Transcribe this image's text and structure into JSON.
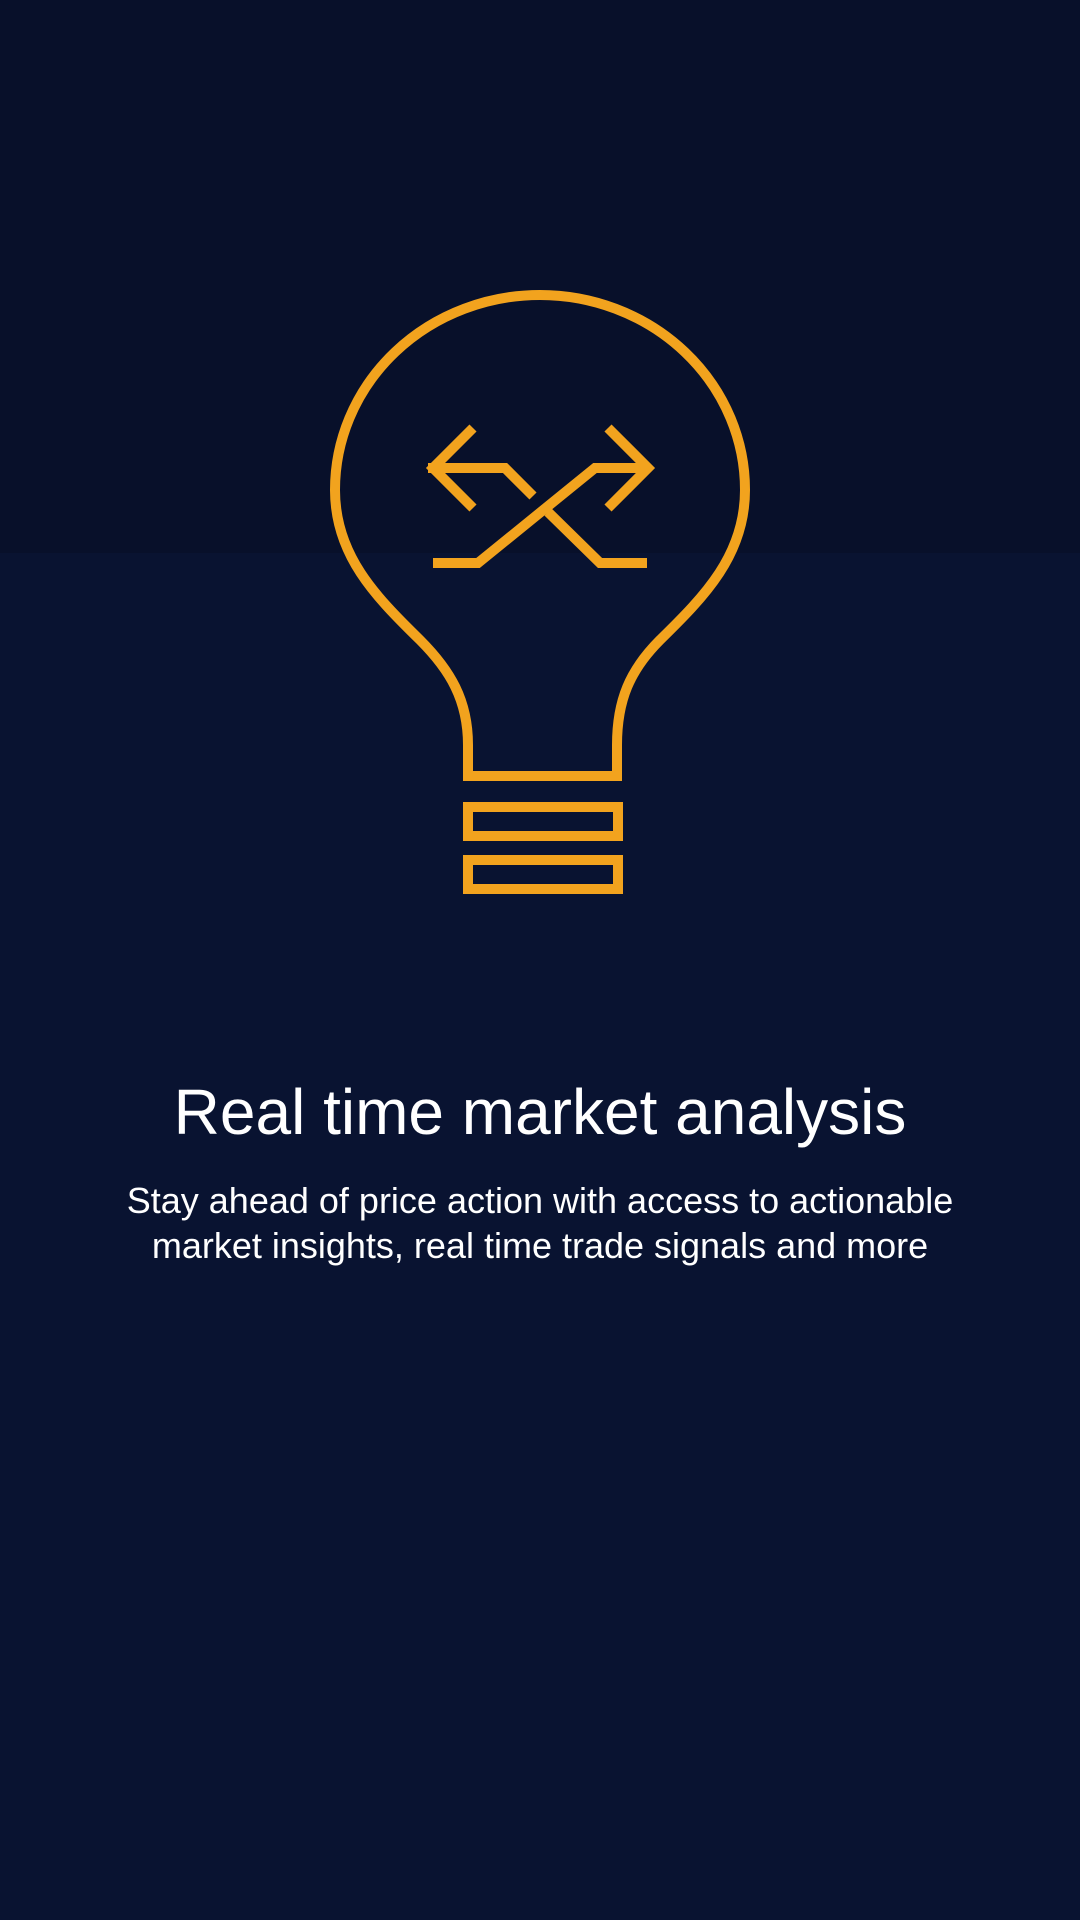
{
  "onboarding": {
    "illustration_icon": "lightbulb-with-crossing-arrows-icon",
    "title": "Real time market analysis",
    "description": "Stay ahead of price action with access to actionable market insights, real time trade signals and more"
  },
  "colors": {
    "background": "#091331",
    "top_band": "#08102a",
    "accent": "#f2a31e",
    "text": "#ffffff"
  }
}
